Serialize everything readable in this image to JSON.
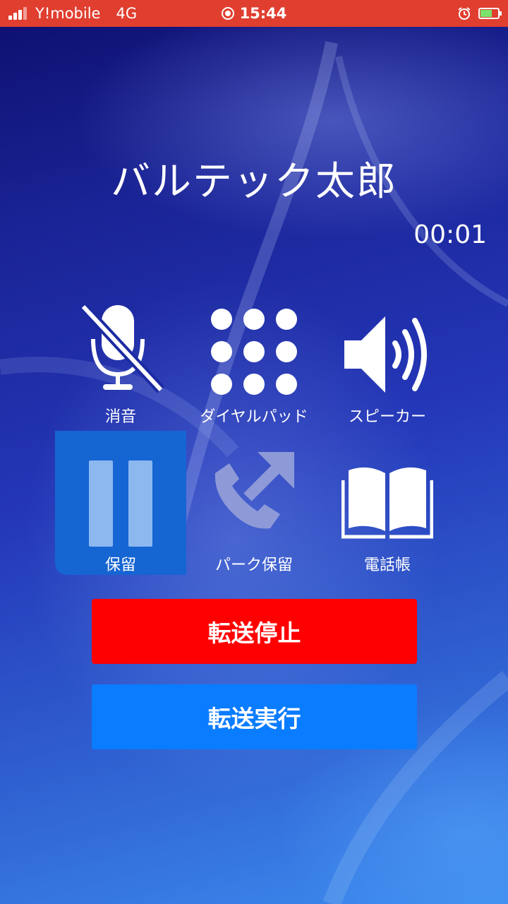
{
  "status_bar": {
    "carrier": "Y!mobile",
    "network": "4G",
    "time": "15:44",
    "signal_bars": 3
  },
  "call": {
    "caller_name": "バルテック太郎",
    "timer": "00:01"
  },
  "controls": {
    "mute_label": "消音",
    "dialpad_label": "ダイヤルパッド",
    "speaker_label": "スピーカー",
    "hold_label": "保留",
    "park_hold_label": "パーク保留",
    "phonebook_label": "電話帳"
  },
  "actions": {
    "transfer_stop_label": "転送停止",
    "transfer_execute_label": "転送実行"
  },
  "colors": {
    "status_bar": "#e03e2f",
    "hold_active": "#1565d3",
    "transfer_stop": "#ff0000",
    "transfer_execute": "#0a7cff"
  }
}
